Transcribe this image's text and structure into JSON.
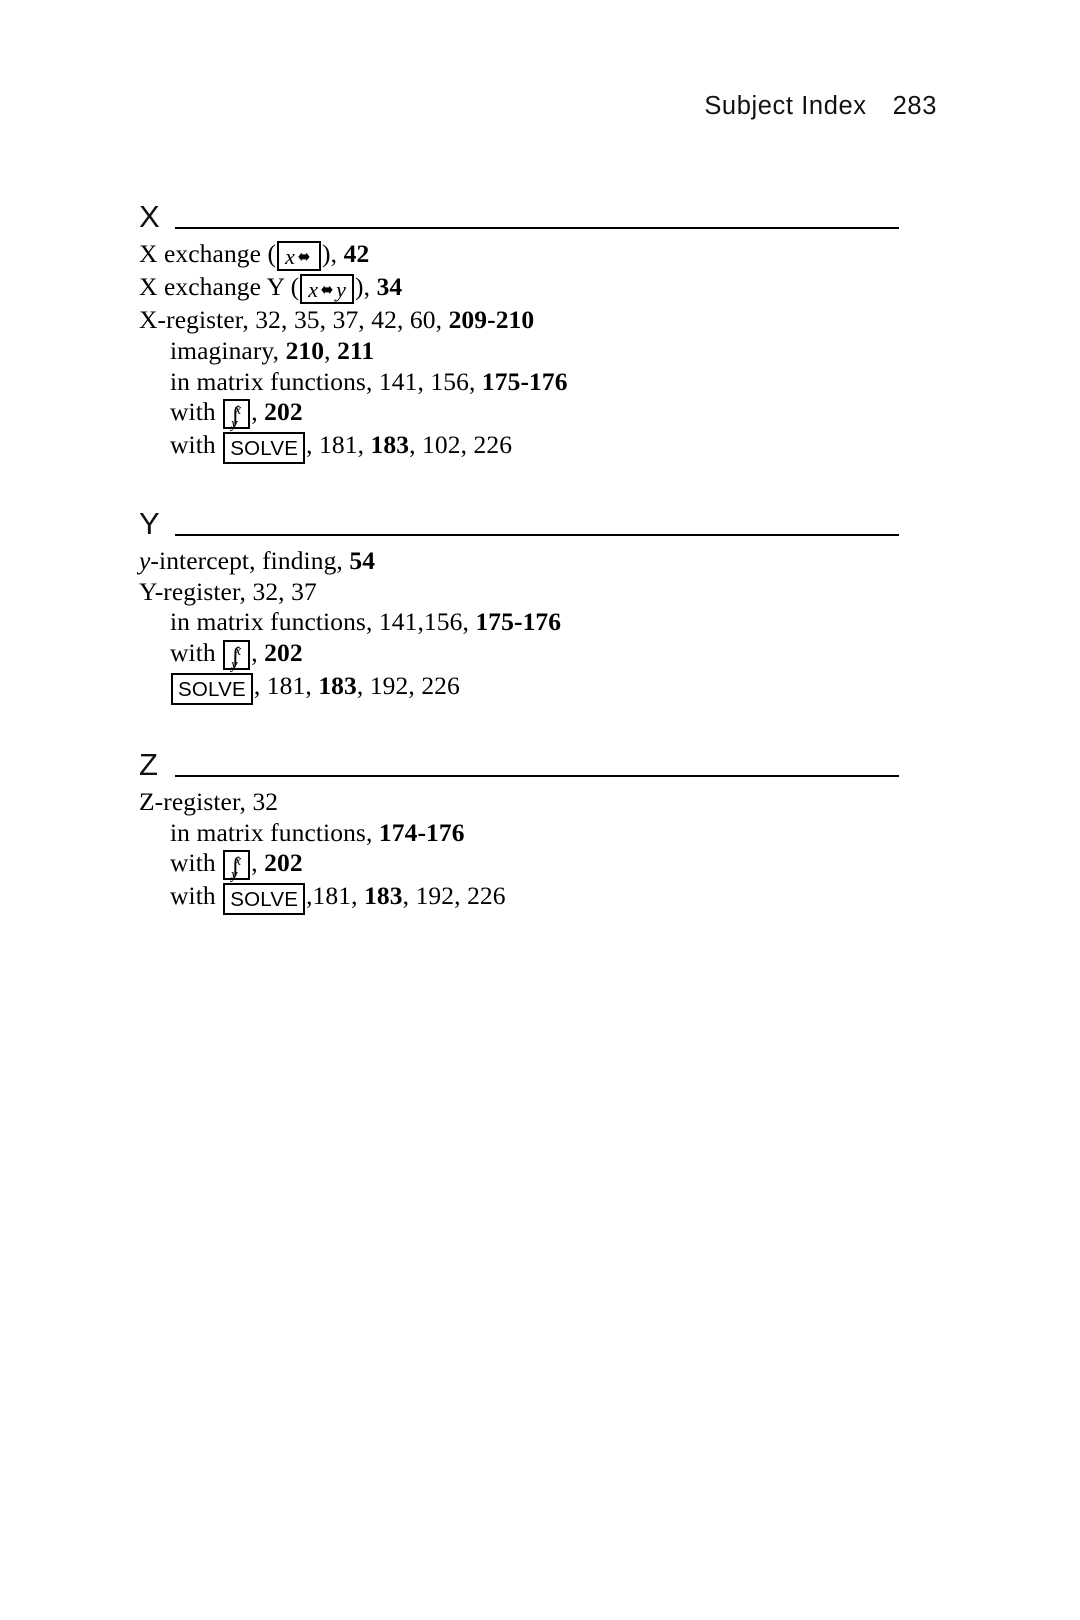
{
  "running_head": {
    "title": "Subject Index",
    "page_number": "283"
  },
  "sections": [
    {
      "letter": "X",
      "entries": [
        {
          "level": 0,
          "parts": [
            {
              "type": "text",
              "text": "X exchange ("
            },
            {
              "type": "key",
              "key": "x-exchange",
              "label": "x⬌"
            },
            {
              "type": "text",
              "text": "), "
            },
            {
              "type": "bold",
              "text": "42"
            }
          ],
          "plain": "X exchange (x⬌), 42"
        },
        {
          "level": 0,
          "parts": [
            {
              "type": "text",
              "text": "X exchange Y ("
            },
            {
              "type": "key",
              "key": "x-exchange-y",
              "label": "x⬌y"
            },
            {
              "type": "text",
              "text": "), "
            },
            {
              "type": "bold",
              "text": "34"
            }
          ],
          "plain": "X exchange Y (x⬌y), 34"
        },
        {
          "level": 0,
          "parts": [
            {
              "type": "text",
              "text": "X-register, 32, 35, 37, 42, 60, "
            },
            {
              "type": "bold",
              "text": "209-210"
            }
          ],
          "plain": "X-register, 32, 35, 37, 42, 60, 209-210"
        },
        {
          "level": 1,
          "parts": [
            {
              "type": "text",
              "text": "imaginary, "
            },
            {
              "type": "bold",
              "text": "210"
            },
            {
              "type": "text",
              "text": ", "
            },
            {
              "type": "bold",
              "text": "211"
            }
          ],
          "plain": "imaginary, 210, 211"
        },
        {
          "level": 1,
          "parts": [
            {
              "type": "text",
              "text": "in matrix functions, 141, 156, "
            },
            {
              "type": "bold",
              "text": "175-176"
            }
          ],
          "plain": "in matrix functions, 141, 156, 175-176"
        },
        {
          "level": 1,
          "parts": [
            {
              "type": "text",
              "text": "with "
            },
            {
              "type": "key",
              "key": "integral",
              "label": "∫ˣᵧ"
            },
            {
              "type": "text",
              "text": ", "
            },
            {
              "type": "bold",
              "text": "202"
            }
          ],
          "plain": "with ∫ˣᵧ, 202"
        },
        {
          "level": 1,
          "parts": [
            {
              "type": "text",
              "text": "with "
            },
            {
              "type": "key",
              "key": "solve",
              "label": "SOLVE"
            },
            {
              "type": "text",
              "text": ", 181, "
            },
            {
              "type": "bold",
              "text": "183"
            },
            {
              "type": "text",
              "text": ", 102, 226"
            }
          ],
          "plain": "with SOLVE, 181, 183, 102, 226"
        }
      ]
    },
    {
      "letter": "Y",
      "entries": [
        {
          "level": 0,
          "parts": [
            {
              "type": "italic",
              "text": "y"
            },
            {
              "type": "text",
              "text": "-intercept, finding, "
            },
            {
              "type": "bold",
              "text": "54"
            }
          ],
          "plain": "y-intercept, finding, 54"
        },
        {
          "level": 0,
          "parts": [
            {
              "type": "text",
              "text": "Y-register, 32, 37"
            }
          ],
          "plain": "Y-register, 32, 37"
        },
        {
          "level": 1,
          "parts": [
            {
              "type": "text",
              "text": "in matrix functions, 141,156, "
            },
            {
              "type": "bold",
              "text": "175-176"
            }
          ],
          "plain": "in matrix functions, 141,156, 175-176"
        },
        {
          "level": 1,
          "parts": [
            {
              "type": "text",
              "text": "with "
            },
            {
              "type": "key",
              "key": "integral",
              "label": "∫ˣᵧ"
            },
            {
              "type": "text",
              "text": ", "
            },
            {
              "type": "bold",
              "text": "202"
            }
          ],
          "plain": "with ∫ˣᵧ, 202"
        },
        {
          "level": 1,
          "parts": [
            {
              "type": "key",
              "key": "solve",
              "label": "SOLVE"
            },
            {
              "type": "text",
              "text": ", 181, "
            },
            {
              "type": "bold",
              "text": "183"
            },
            {
              "type": "text",
              "text": ", 192, 226"
            }
          ],
          "plain": "SOLVE, 181, 183, 192, 226"
        }
      ]
    },
    {
      "letter": "Z",
      "entries": [
        {
          "level": 0,
          "parts": [
            {
              "type": "text",
              "text": "Z-register, 32"
            }
          ],
          "plain": "Z-register, 32"
        },
        {
          "level": 1,
          "parts": [
            {
              "type": "text",
              "text": "in matrix functions, "
            },
            {
              "type": "bold",
              "text": "174-176"
            }
          ],
          "plain": "in matrix functions, 174-176"
        },
        {
          "level": 1,
          "parts": [
            {
              "type": "text",
              "text": "with "
            },
            {
              "type": "key",
              "key": "integral",
              "label": "∫ˣᵧ"
            },
            {
              "type": "text",
              "text": ", "
            },
            {
              "type": "bold",
              "text": "202"
            }
          ],
          "plain": "with ∫ˣᵧ, 202"
        },
        {
          "level": 1,
          "parts": [
            {
              "type": "text",
              "text": "with "
            },
            {
              "type": "key",
              "key": "solve",
              "label": "SOLVE"
            },
            {
              "type": "text",
              "text": ",181, "
            },
            {
              "type": "bold",
              "text": "183"
            },
            {
              "type": "text",
              "text": ", 192, 226"
            }
          ],
          "plain": "with SOLVE,181, 183, 192, 226"
        }
      ]
    }
  ],
  "keys": {
    "x-exchange": {
      "left": "x",
      "swap": "⬌",
      "right": ""
    },
    "x-exchange-y": {
      "left": "x",
      "swap": "⬌",
      "right": "y"
    },
    "integral": {
      "symbol": "∫",
      "sup": "x",
      "sub": "y"
    },
    "solve": {
      "text": "SOLVE"
    }
  },
  "colors": {
    "text": "#000000",
    "rule": "#000000",
    "background": "#ffffff"
  }
}
